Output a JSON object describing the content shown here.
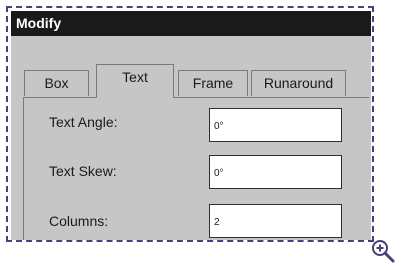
{
  "dialog": {
    "title": "Modify",
    "tabs": [
      {
        "label": "Box"
      },
      {
        "label": "Text"
      },
      {
        "label": "Frame"
      },
      {
        "label": "Runaround"
      }
    ],
    "active_tab": "Text",
    "fields": [
      {
        "label": "Text Angle:",
        "value": "0°"
      },
      {
        "label": "Text Skew:",
        "value": "0°"
      },
      {
        "label": "Columns:",
        "value": "2"
      }
    ]
  },
  "colors": {
    "titlebar": "#1a1a1a",
    "dialog_bg": "#c6c6c6",
    "dashed_border": "#4a3f7a"
  },
  "icons": {
    "zoom": "magnifier-plus-icon"
  }
}
